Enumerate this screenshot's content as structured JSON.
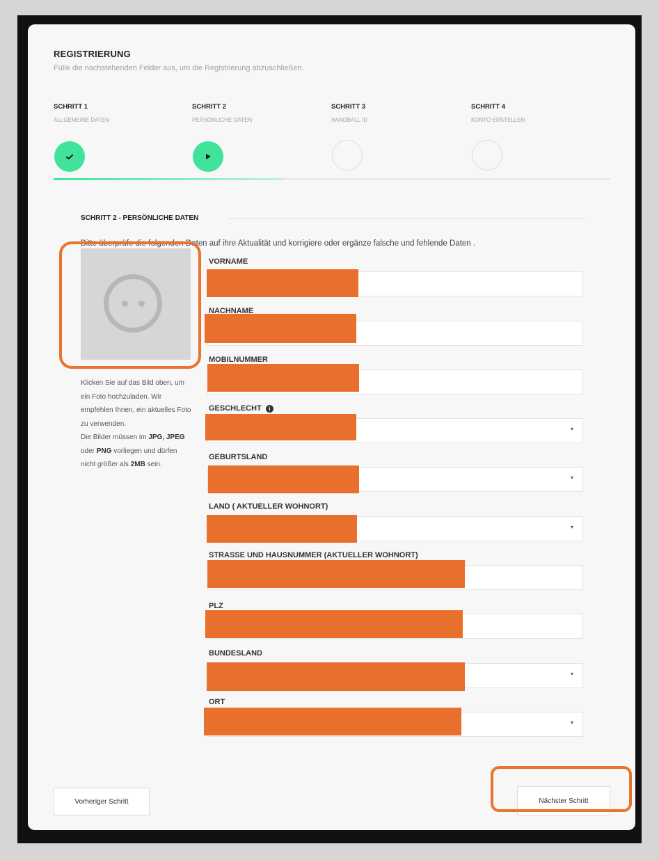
{
  "header": {
    "title": "REGISTRIERUNG",
    "subtitle": "Fülle die nachstehenden Felder aus, um die Registrierung abzuschließen."
  },
  "steps": [
    {
      "title": "SCHRITT 1",
      "subtitle": "ALLGEMEINE DATEN",
      "status": "done",
      "icon": "check-icon"
    },
    {
      "title": "SCHRITT 2",
      "subtitle": "PERSÖNLICHE DATEN",
      "status": "current",
      "icon": "play-icon"
    },
    {
      "title": "SCHRITT 3",
      "subtitle": "HANDBALL ID",
      "status": "pending"
    },
    {
      "title": "SCHRITT 4",
      "subtitle": "KONTO ERSTELLEN",
      "status": "pending"
    }
  ],
  "progress_fraction": 0.41,
  "section": {
    "title": "SCHRITT 2 - PERSÖNLICHE DATEN",
    "instruction": "Bitte überprüfe die folgenden Daten auf ihre Aktualität und korrigiere oder ergänze falsche und fehlende Daten ."
  },
  "photo": {
    "help_part1": "Klicken Sie auf das Bild oben, um ein Foto hochzuladen. Wir empfehlen Ihnen, ein aktuelles Foto zu verwenden.",
    "help_part2": "Die Bilder müssen im",
    "fmt1": "JPG,",
    "fmt2": "JPEG",
    "oder": "oder",
    "fmt3": "PNG",
    "help_part3": "vorliegen und dürfen nicht größer als",
    "size": "2MB",
    "sein": "sein."
  },
  "fields": {
    "vorname": {
      "label": "VORNAME"
    },
    "nachname": {
      "label": "NACHNAME"
    },
    "mobil": {
      "label": "MOBILNUMMER"
    },
    "geschlecht": {
      "label": "GESCHLECHT",
      "info_icon": "info-icon"
    },
    "geburtsland": {
      "label": "GEBURTSLAND"
    },
    "land": {
      "label": "LAND ( AKTUELLER WOHNORT)"
    },
    "strasse": {
      "label": "STRASSE UND HAUSNUMMER (AKTUELLER WOHNORT)"
    },
    "plz": {
      "label": "PLZ"
    },
    "bundesland": {
      "label": "BUNDESLAND"
    },
    "ort": {
      "label": "ORT"
    }
  },
  "buttons": {
    "prev": "Vorheriger Schritt",
    "next": "Nächster Schritt"
  },
  "colors": {
    "accent": "#3fe39a",
    "highlight": "#e8742e",
    "redaction": "#e96f2c"
  }
}
